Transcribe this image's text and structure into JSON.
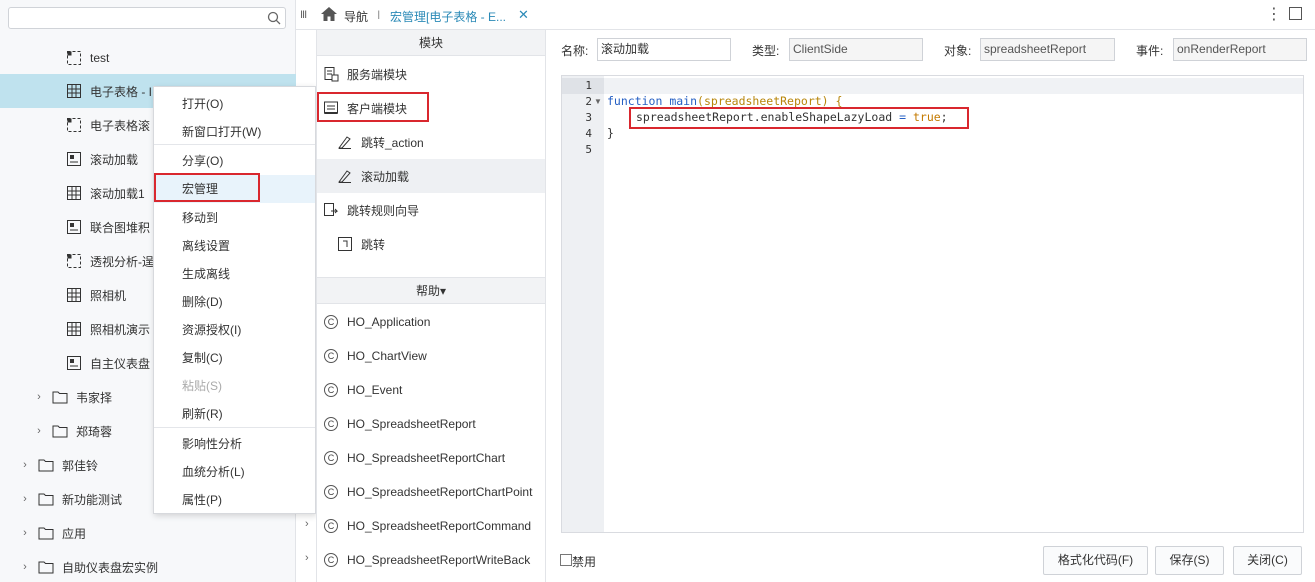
{
  "search": {
    "placeholder": ""
  },
  "tree": [
    {
      "label": "test",
      "icon": "pivot-icon"
    },
    {
      "label": "电子表格 - I",
      "icon": "table-icon",
      "selected": true
    },
    {
      "label": "电子表格滚",
      "icon": "pivot-icon"
    },
    {
      "label": "滚动加载",
      "icon": "dashboard-icon"
    },
    {
      "label": "滚动加载1",
      "icon": "table-icon"
    },
    {
      "label": "联合图堆积",
      "icon": "dashboard-icon"
    },
    {
      "label": "透视分析-逞",
      "icon": "pivot-icon"
    },
    {
      "label": "照相机",
      "icon": "table-icon"
    },
    {
      "label": "照相机演示",
      "icon": "table-icon"
    },
    {
      "label": "自主仪表盘",
      "icon": "dashboard-icon"
    },
    {
      "label": "韦家择",
      "icon": "folder-icon"
    },
    {
      "label": "郑琦蓉",
      "icon": "folder-icon"
    },
    {
      "label": "郭佳铃",
      "icon": "folder-icon"
    },
    {
      "label": "新功能测试",
      "icon": "folder-icon"
    },
    {
      "label": "应用",
      "icon": "folder-icon"
    },
    {
      "label": "自助仪表盘宏实例",
      "icon": "folder-icon"
    }
  ],
  "context_menu": [
    {
      "label": "打开(O)",
      "disabled": false
    },
    {
      "label": "新窗口打开(W)",
      "disabled": false
    },
    {
      "label": "分享(O)",
      "disabled": false
    },
    {
      "label": "宏管理",
      "disabled": false
    },
    {
      "label": "移动到",
      "disabled": false
    },
    {
      "label": "离线设置",
      "disabled": false
    },
    {
      "label": "生成离线",
      "disabled": false
    },
    {
      "label": "删除(D)",
      "disabled": false
    },
    {
      "label": "资源授权(I)",
      "disabled": false
    },
    {
      "label": "复制(C)",
      "disabled": false
    },
    {
      "label": "粘贴(S)",
      "disabled": true
    },
    {
      "label": "刷新(R)",
      "disabled": false
    },
    {
      "label": "影响性分析",
      "disabled": false
    },
    {
      "label": "血统分析(L)",
      "disabled": false
    },
    {
      "label": "属性(P)",
      "disabled": false
    }
  ],
  "topbar": {
    "nav_label": "导航",
    "separator": "I",
    "tab_label": "宏管理[电子表格 - E...",
    "close_glyph": "✕",
    "more_glyph": "⋮"
  },
  "modules": {
    "header": "模块",
    "items": [
      {
        "label": "服务端模块"
      },
      {
        "label": "客户端模块"
      },
      {
        "label": "跳转_action"
      },
      {
        "label": "滚动加载"
      },
      {
        "label": "跳转规则向导"
      },
      {
        "label": "跳转"
      }
    ]
  },
  "help": {
    "header": "帮助▾",
    "items": [
      "HO_Application",
      "HO_ChartView",
      "HO_Event",
      "HO_SpreadsheetReport",
      "HO_SpreadsheetReportChart",
      "HO_SpreadsheetReportChartPoint",
      "HO_SpreadsheetReportCommand",
      "HO_SpreadsheetReportWriteBack"
    ]
  },
  "form": {
    "name_label": "名称:",
    "name_value": "滚动加载",
    "type_label": "类型:",
    "type_value": "ClientSide",
    "object_label": "对象:",
    "object_value": "spreadsheetReport",
    "event_label": "事件:",
    "event_value": "onRenderReport"
  },
  "code": {
    "line_numbers": [
      "1",
      "2",
      "3",
      "4",
      "5"
    ],
    "line2_kw": "function",
    "line2_fn": "main",
    "line2_open": "(",
    "line2_param": "spreadsheetReport",
    "line2_close": ") {",
    "line3_obj": "spreadsheetReport",
    "line3_prop": ".enableShapeLazyLoad",
    "line3_op": " = ",
    "line3_val": "true",
    "line3_end": ";",
    "line4": "}"
  },
  "footer": {
    "disable_label": "禁用",
    "format_button": "格式化代码(F)",
    "save_button": "保存(S)",
    "close_button": "关闭(C)"
  },
  "colors": {
    "accent": "#2b8ab7",
    "highlight_border": "#d9272e",
    "selected_row": "#bfe2ee"
  }
}
